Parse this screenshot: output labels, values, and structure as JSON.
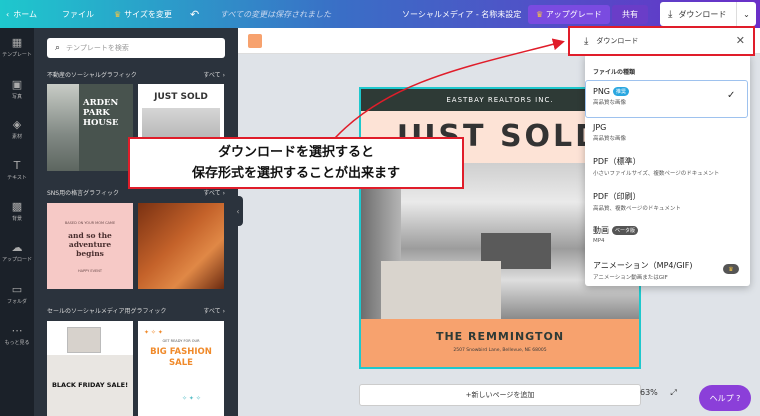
{
  "topbar": {
    "home": "ホーム",
    "file": "ファイル",
    "resize": "サイズを変更",
    "saved": "すべての変更は保存されました",
    "doc_title": "ソーシャルメディア - 名称未設定",
    "upgrade": "アップグレード",
    "share": "共有",
    "download": "ダウンロード"
  },
  "sidebar": {
    "items": [
      {
        "label": "テンプレート",
        "icon": "template-icon"
      },
      {
        "label": "写真",
        "icon": "photo-icon"
      },
      {
        "label": "素材",
        "icon": "elements-icon"
      },
      {
        "label": "テキスト",
        "icon": "text-icon"
      },
      {
        "label": "背景",
        "icon": "background-icon"
      },
      {
        "label": "アップロード",
        "icon": "upload-icon"
      },
      {
        "label": "フォルダ",
        "icon": "folder-icon"
      },
      {
        "label": "もっと見る",
        "icon": "more-icon"
      }
    ]
  },
  "panel": {
    "search_placeholder": "テンプレートを検索",
    "see_all": "すべて",
    "sections": [
      {
        "title": "不動産のソーシャルグラフィック"
      },
      {
        "title": "SNS用の格言グラフィック"
      },
      {
        "title": "セールのソーシャルメディア用グラフィック"
      }
    ],
    "thumbs": {
      "arden": "ARDEN PARK HOUSE",
      "just_sold": "JUST SOLD",
      "adventure": "and so the adventure begins",
      "adventure_top": "BASED ON YOUR MOM CAME",
      "adventure_bottom": "HAPPY EVENT",
      "black_friday": "BLACK FRIDAY SALE!",
      "big_fashion": "BIG FASHION SALE",
      "big_fashion_top": "GET READY FOR OUR"
    }
  },
  "doc": {
    "header": "EASTBAY REALTORS INC.",
    "headline": "JUST SOLD",
    "name": "THE REMMINGTON",
    "address": "2507 Snowbird Lane, Bellevue, NE 68005"
  },
  "canvas": {
    "add_page": "+新しいページを追加",
    "zoom": "63%",
    "help": "ヘルプ ?"
  },
  "download_panel": {
    "title": "ダウンロード",
    "file_type_label": "ファイルの種類",
    "options": [
      {
        "title": "PNG",
        "badge": "推奨",
        "sub": "高品質な画像",
        "selected": true
      },
      {
        "title": "JPG",
        "badge": "",
        "sub": "高品質な画像",
        "selected": false
      },
      {
        "title": "PDF（標準）",
        "badge": "",
        "sub": "小さいファイルサイズ、複数ページのドキュメント",
        "selected": false
      },
      {
        "title": "PDF（印刷）",
        "badge": "",
        "sub": "高品質、複数ページのドキュメント",
        "selected": false
      },
      {
        "title": "動画",
        "badge": "ベータ版",
        "sub": "MP4",
        "selected": false
      },
      {
        "title": "アニメーション（MP4/GIF)",
        "badge": "",
        "sub": "アニメーション動画またはGIF",
        "selected": false
      }
    ]
  },
  "callout": {
    "line1": "ダウンロードを選択すると",
    "line2": "保存形式を選択することが出来ます"
  },
  "colors": {
    "accent_teal": "#1ec8cd",
    "doc_orange": "#f7a26e",
    "doc_peach": "#fde3d6",
    "callout_red": "#e01d2a",
    "help_purple": "#8b3fd9"
  }
}
